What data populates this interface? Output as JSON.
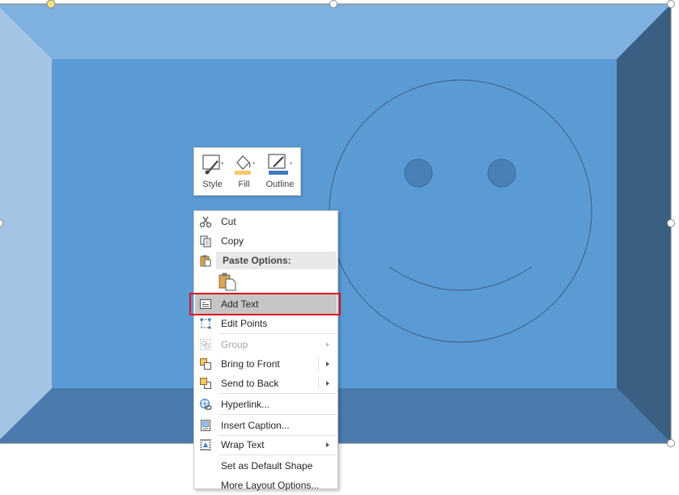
{
  "mini_toolbar": {
    "style_label": "Style",
    "fill_label": "Fill",
    "outline_label": "Outline"
  },
  "context_menu": {
    "cut": "Cut",
    "copy": "Copy",
    "paste_options": "Paste Options:",
    "add_text": "Add Text",
    "edit_points": "Edit Points",
    "group": "Group",
    "bring_to_front": "Bring to Front",
    "send_to_back": "Send to Back",
    "hyperlink": "Hyperlink...",
    "insert_caption": "Insert Caption...",
    "wrap_text": "Wrap Text",
    "set_default_shape": "Set as Default Shape",
    "more_layout_options": "More Layout Options..."
  },
  "colors": {
    "shape_face": "#5b9bd5",
    "bevel_top": "#7eb1df",
    "bevel_left": "#a3c4e5",
    "bevel_right": "#3a5f82",
    "bevel_bottom": "#4a7bac",
    "highlight_outline": "#e0141e",
    "outline_accent": "#3e7bbf",
    "fill_accent": "#f5c86a"
  }
}
